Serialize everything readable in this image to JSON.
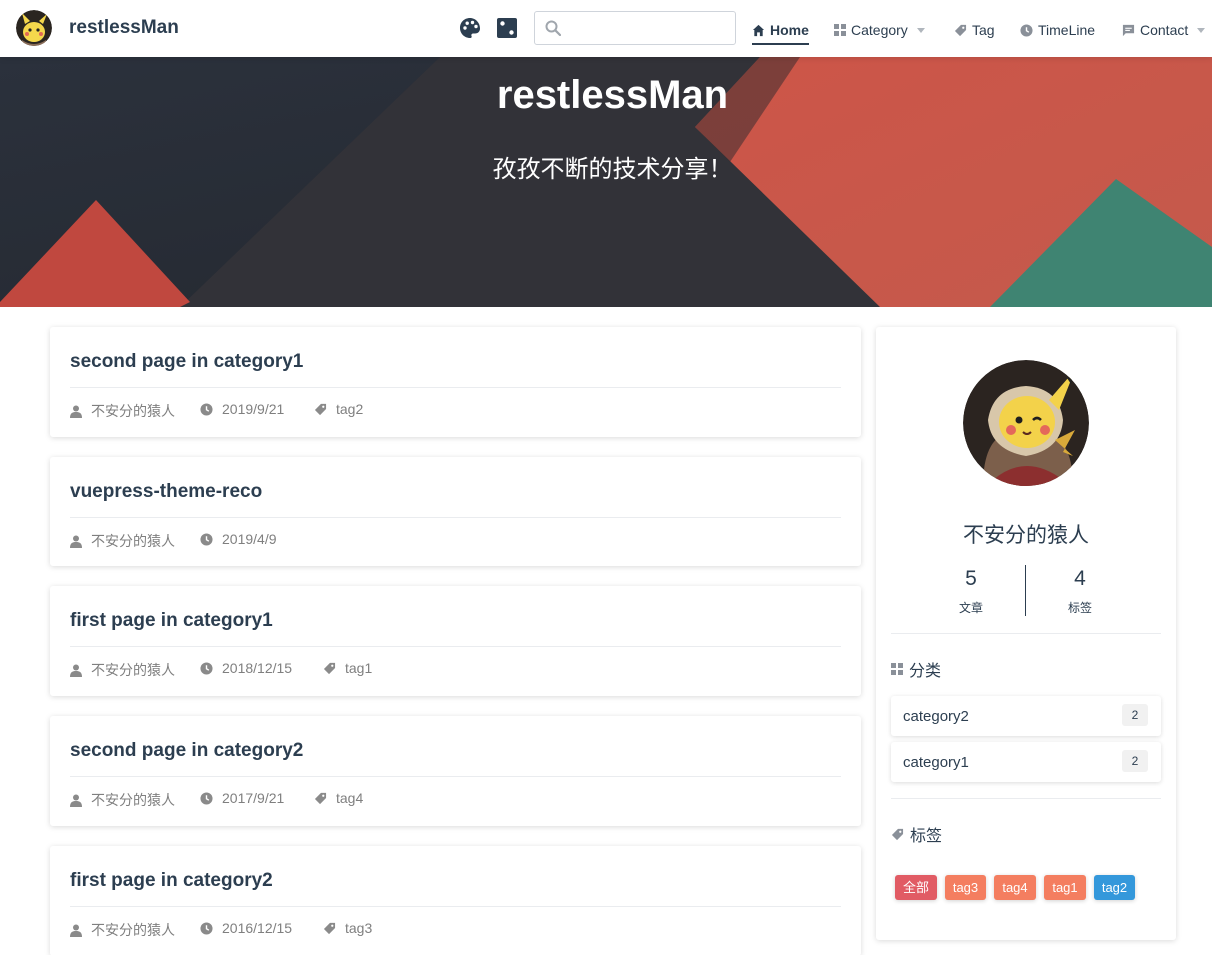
{
  "navbar": {
    "title": "restlessMan",
    "search": {
      "value": "",
      "placeholder": ""
    },
    "items": [
      {
        "label": "Home",
        "icon": "home-icon",
        "active": true
      },
      {
        "label": "Category",
        "icon": "category-grid-icon",
        "dropdown": true
      },
      {
        "label": "Tag",
        "icon": "tag-icon"
      },
      {
        "label": "TimeLine",
        "icon": "clock-icon"
      },
      {
        "label": "Contact",
        "icon": "message-icon",
        "dropdown": true
      }
    ],
    "tools": [
      "palette-icon",
      "dice-icon"
    ]
  },
  "hero": {
    "title": "restlessMan",
    "description": "孜孜不断的技术分享！"
  },
  "posts": [
    {
      "title": "second page in category1",
      "author": "不安分的猿人",
      "date": "2019/9/21",
      "tags": [
        "tag2"
      ]
    },
    {
      "title": "vuepress-theme-reco",
      "author": "不安分的猿人",
      "date": "2019/4/9",
      "tags": []
    },
    {
      "title": "first page in category1",
      "author": "不安分的猿人",
      "date": "2018/12/15",
      "tags": [
        "tag1"
      ]
    },
    {
      "title": "second page in category2",
      "author": "不安分的猿人",
      "date": "2017/9/21",
      "tags": [
        "tag4"
      ]
    },
    {
      "title": "first page in category2",
      "author": "不安分的猿人",
      "date": "2016/12/15",
      "tags": [
        "tag3"
      ]
    }
  ],
  "sidebar": {
    "author": "不安分的猿人",
    "stats": [
      {
        "num": "5",
        "label": "文章"
      },
      {
        "num": "4",
        "label": "标签"
      }
    ],
    "category_heading": "分类",
    "categories": [
      {
        "name": "category2",
        "count": "2"
      },
      {
        "name": "category1",
        "count": "2"
      }
    ],
    "tag_heading": "标签",
    "tags": [
      {
        "label": "全部",
        "color": "#e15b64"
      },
      {
        "label": "tag3",
        "color": "#f47e60"
      },
      {
        "label": "tag4",
        "color": "#f47e60"
      },
      {
        "label": "tag1",
        "color": "#f47e60"
      },
      {
        "label": "tag2",
        "color": "#3498db"
      }
    ]
  },
  "colors": {
    "text": "#2c3e50",
    "meta": "#7f7f7f",
    "hero_dark": "#2e2f35",
    "hero_red": "#c9584c",
    "hero_green": "#3d8370"
  }
}
